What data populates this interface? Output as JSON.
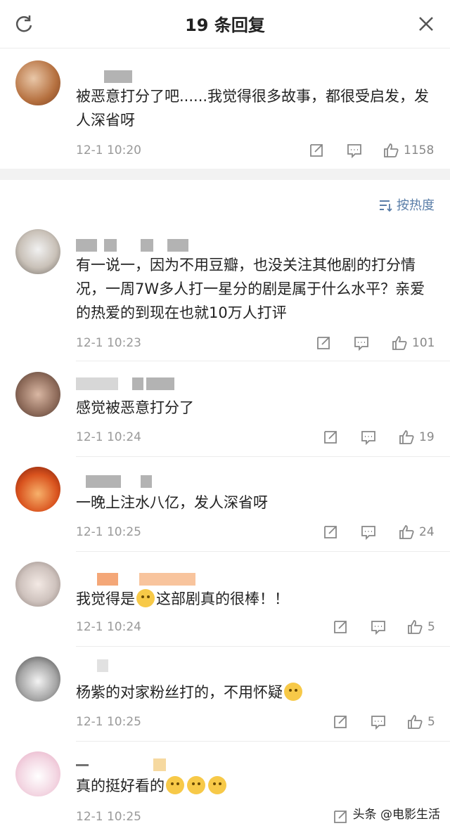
{
  "header": {
    "title": "19 条回复"
  },
  "sort": {
    "label": "按热度"
  },
  "top_comment": {
    "text": "被恶意打分了吧......我觉得很多故事，都很受启发，发人深省呀",
    "time": "12-1 10:20",
    "likes": "1158"
  },
  "replies": [
    {
      "text": "有一说一，因为不用豆瓣，也没关注其他剧的打分情况，一周7W多人打一星分的剧是属于什么水平？亲爱的热爱的到现在也就10万人打评",
      "time": "12-1 10:23",
      "likes": "101"
    },
    {
      "text": "感觉被恶意打分了",
      "time": "12-1 10:24",
      "likes": "19"
    },
    {
      "text": "一晚上注水八亿，发人深省呀",
      "time": "12-1 10:25",
      "likes": "24"
    },
    {
      "text_before": "我觉得是",
      "text_after": "这部剧真的很棒！！",
      "time": "12-1 10:24",
      "likes": "5"
    },
    {
      "text": "杨紫的对家粉丝打的，不用怀疑",
      "time": "12-1 10:25",
      "likes": "5"
    },
    {
      "text": "真的挺好看的",
      "time": "12-1 10:25",
      "likes": ""
    }
  ],
  "icons": {
    "refresh": "refresh-icon",
    "close": "close-icon",
    "share": "share-icon",
    "comment": "comment-icon",
    "like": "thumbs-up-icon",
    "sort": "sort-icon"
  },
  "colors": {
    "link": "#5a7ea8",
    "meta": "#999999",
    "divider": "#ececec"
  },
  "watermark": "头条 @电影生活"
}
